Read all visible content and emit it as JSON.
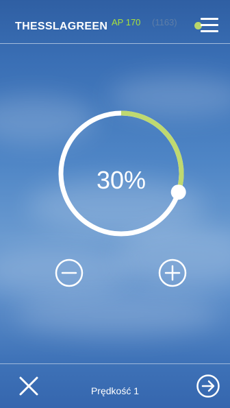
{
  "header": {
    "brand": "THESSLAGREEN",
    "model": "AP 170",
    "serial": "(1163)",
    "status_color": "#b9d66a",
    "menu_icon": "hamburger-menu-icon"
  },
  "dial": {
    "value_label": "30%",
    "level": 0.3,
    "track_color": "#ffffff",
    "fill_color": "#bfd970",
    "knob_color": "#ffffff"
  },
  "controls": {
    "decrease_icon": "minus-circle-icon",
    "increase_icon": "plus-circle-icon"
  },
  "footer": {
    "close_icon": "close-icon",
    "speed_label": "Prędkość 1",
    "next_icon": "arrow-right-circle-icon"
  }
}
